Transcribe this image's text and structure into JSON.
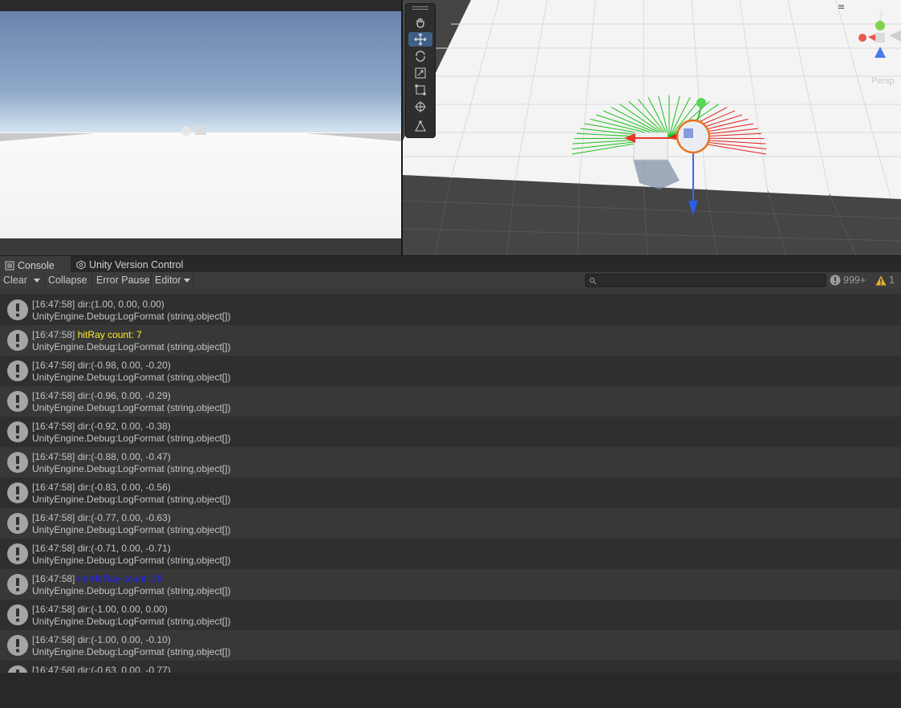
{
  "tabs": {
    "console": "Console",
    "version_control": "Unity Version Control"
  },
  "toolbar": {
    "clear": "Clear",
    "collapse": "Collapse",
    "error_pause": "Error Pause",
    "editor": "Editor",
    "search_placeholder": ""
  },
  "counters": {
    "info": "999+",
    "warnings": "1"
  },
  "gizmo": {
    "axis_y": "y",
    "persp": "Persp"
  },
  "logs": [
    {
      "time": "[16:47:58]",
      "msg": "dir:(1.00, 0.00, 0.00)",
      "stack": "UnityEngine.Debug:LogFormat (string,object[])"
    },
    {
      "time": "[16:47:58]",
      "msg": "hitRay count: 7",
      "stack": "UnityEngine.Debug:LogFormat (string,object[])",
      "color": "yellow"
    },
    {
      "time": "[16:47:58]",
      "msg": "dir:(-0.98, 0.00, -0.20)",
      "stack": "UnityEngine.Debug:LogFormat (string,object[])"
    },
    {
      "time": "[16:47:58]",
      "msg": "dir:(-0.96, 0.00, -0.29)",
      "stack": "UnityEngine.Debug:LogFormat (string,object[])"
    },
    {
      "time": "[16:47:58]",
      "msg": "dir:(-0.92, 0.00, -0.38)",
      "stack": "UnityEngine.Debug:LogFormat (string,object[])"
    },
    {
      "time": "[16:47:58]",
      "msg": "dir:(-0.88, 0.00, -0.47)",
      "stack": "UnityEngine.Debug:LogFormat (string,object[])"
    },
    {
      "time": "[16:47:58]",
      "msg": "dir:(-0.83, 0.00, -0.56)",
      "stack": "UnityEngine.Debug:LogFormat (string,object[])"
    },
    {
      "time": "[16:47:58]",
      "msg": "dir:(-0.77, 0.00, -0.63)",
      "stack": "UnityEngine.Debug:LogFormat (string,object[])"
    },
    {
      "time": "[16:47:58]",
      "msg": "dir:(-0.71, 0.00, -0.71)",
      "stack": "UnityEngine.Debug:LogFormat (string,object[])"
    },
    {
      "time": "[16:47:58]",
      "msg": "notHitRay count: 26",
      "stack": "UnityEngine.Debug:LogFormat (string,object[])",
      "color": "blue"
    },
    {
      "time": "[16:47:58]",
      "msg": "dir:(-1.00, 0.00, 0.00)",
      "stack": "UnityEngine.Debug:LogFormat (string,object[])"
    },
    {
      "time": "[16:47:58]",
      "msg": "dir:(-1.00, 0.00, -0.10)",
      "stack": "UnityEngine.Debug:LogFormat (string,object[])"
    },
    {
      "time": "[16:47:58]",
      "msg": "dir:(-0.63, 0.00, -0.77)",
      "stack": ""
    }
  ]
}
